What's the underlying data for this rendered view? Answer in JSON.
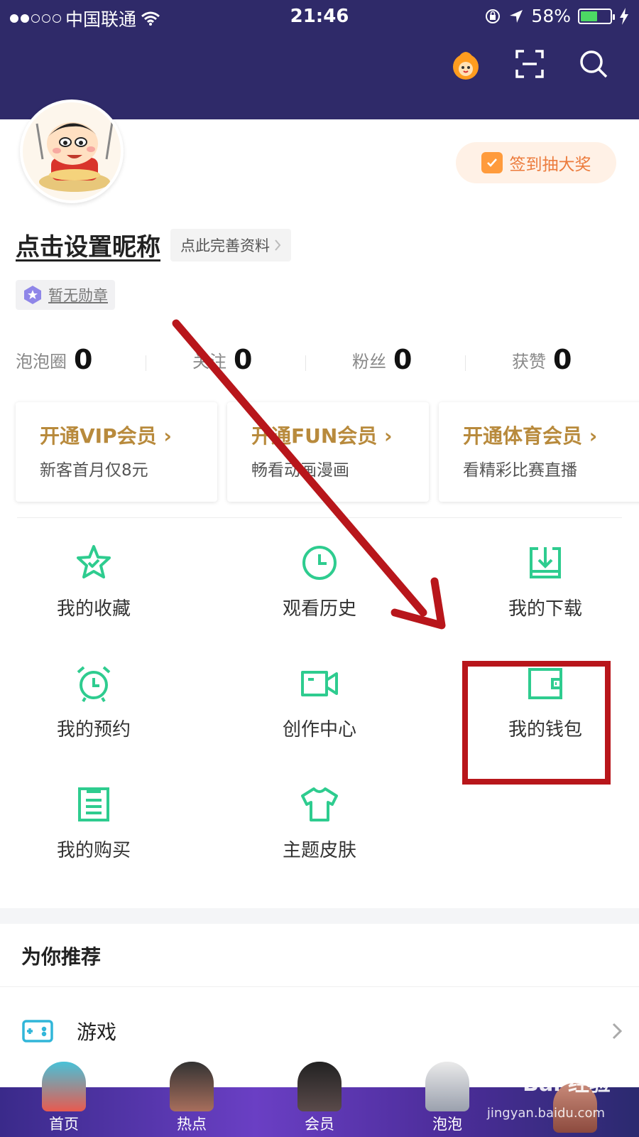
{
  "status": {
    "carrier": "中国联通",
    "time": "21:46",
    "battery": "58%",
    "battery_level": 0.58,
    "signal_filled": 2,
    "signal_total": 5
  },
  "header": {
    "icons": [
      "mascot-icon",
      "scan-icon",
      "search-icon"
    ]
  },
  "profile": {
    "nickname": "点击设置昵称",
    "complete_label": "点此完善资料",
    "medal_label": "暂无勋章",
    "checkin_label": "签到抽大奖"
  },
  "stats": [
    {
      "label": "泡泡圈",
      "value": "0"
    },
    {
      "label": "关注",
      "value": "0"
    },
    {
      "label": "粉丝",
      "value": "0"
    },
    {
      "label": "获赞",
      "value": "0"
    }
  ],
  "vip_cards": [
    {
      "title": "开通VIP会员 ›",
      "subtitle": "新客首月仅8元"
    },
    {
      "title": "开通FUN会员 ›",
      "subtitle": "畅看动画漫画"
    },
    {
      "title": "开通体育会员 ›",
      "subtitle": "看精彩比赛直播"
    }
  ],
  "menu": [
    {
      "label": "我的收藏",
      "icon": "star-icon"
    },
    {
      "label": "观看历史",
      "icon": "clock-icon"
    },
    {
      "label": "我的下载",
      "icon": "download-icon"
    },
    {
      "label": "我的预约",
      "icon": "alarm-icon"
    },
    {
      "label": "创作中心",
      "icon": "video-camera-icon"
    },
    {
      "label": "我的钱包",
      "icon": "wallet-icon"
    },
    {
      "label": "我的购买",
      "icon": "clipboard-icon"
    },
    {
      "label": "主题皮肤",
      "icon": "tshirt-icon"
    }
  ],
  "recommend": {
    "title": "为你推荐",
    "items": [
      {
        "label": "游戏",
        "icon": "gamepad-icon"
      }
    ]
  },
  "tabbar": [
    {
      "label": "首页"
    },
    {
      "label": "热点"
    },
    {
      "label": "会员"
    },
    {
      "label": "泡泡"
    },
    {
      "label": ""
    }
  ],
  "watermark": {
    "brand": "Bai 经验",
    "url": "jingyan.baidu.com"
  },
  "colors": {
    "header_bg": "#2f2a69",
    "accent_green": "#2ecc8f",
    "vip_gold": "#b88a3c",
    "annotation_red": "#b8161b"
  }
}
